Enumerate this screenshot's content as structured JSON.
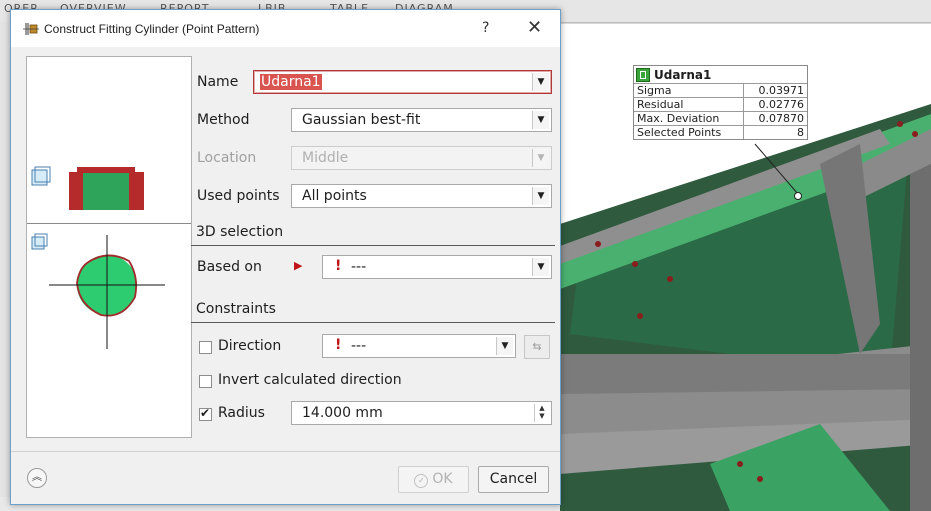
{
  "background": {
    "tabs": [
      "ORER",
      "OVERVIEW",
      "REPORT",
      "LBIB",
      "TABLE",
      "DIAGRAM"
    ]
  },
  "dialog": {
    "title": "Construct Fitting Cylinder (Point Pattern)",
    "help": "?",
    "close": "✕",
    "name_label": "Name",
    "name_value": "Udarna1",
    "method_label": "Method",
    "method_value": "Gaussian best-fit",
    "location_label": "Location",
    "location_value": "Middle",
    "used_points_label": "Used points",
    "used_points_value": "All points",
    "selection_head": "3D selection",
    "based_on_label": "Based on",
    "based_on_value": "---",
    "constraints_head": "Constraints",
    "direction_label": "Direction",
    "direction_value": "---",
    "direction_checked": false,
    "invert_label": "Invert calculated direction",
    "invert_checked": false,
    "radius_label": "Radius",
    "radius_value": "14.000 mm",
    "radius_checked": true,
    "ok_label": "OK",
    "cancel_label": "Cancel"
  },
  "tooltip": {
    "title": "Udarna1",
    "rows": [
      {
        "label": "Sigma",
        "value": "0.03971"
      },
      {
        "label": "Residual",
        "value": "0.02776"
      },
      {
        "label": "Max. Deviation",
        "value": "0.07870"
      },
      {
        "label": "Selected Points",
        "value": "8"
      }
    ]
  },
  "colors": {
    "accent_green": "#2ea35a",
    "warning_red": "#c0141b",
    "cylinder_red": "#b52a2a"
  }
}
